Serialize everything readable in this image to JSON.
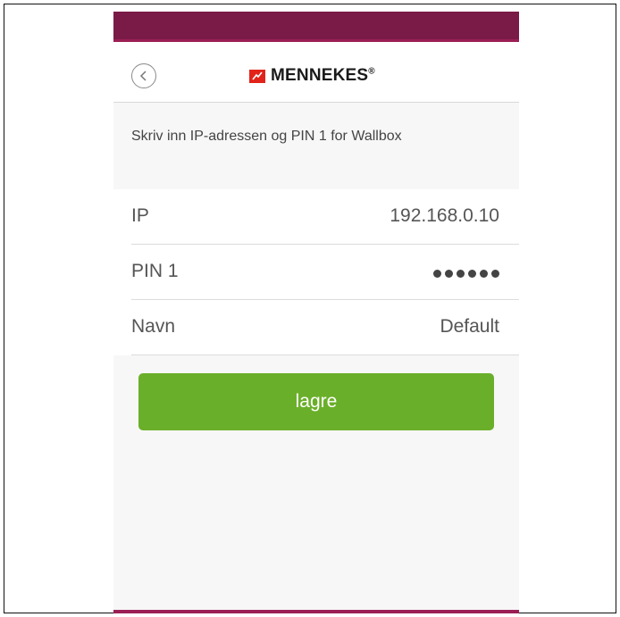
{
  "header": {
    "brand": "MENNEKES",
    "registered_mark": "®",
    "back_icon": "chevron-left-icon",
    "brand_color": "#e2231a"
  },
  "instruction": "Skriv inn IP-adressen og PIN 1 for Wallbox",
  "form": {
    "ip": {
      "label": "IP",
      "value": "192.168.0.10"
    },
    "pin": {
      "label": "PIN 1",
      "masked_length": 6
    },
    "name": {
      "label": "Navn",
      "value": "Default"
    }
  },
  "save_button": {
    "label": "lagre",
    "color": "#6aaf2a"
  },
  "theme": {
    "top_bar_color": "#7a1a47"
  }
}
